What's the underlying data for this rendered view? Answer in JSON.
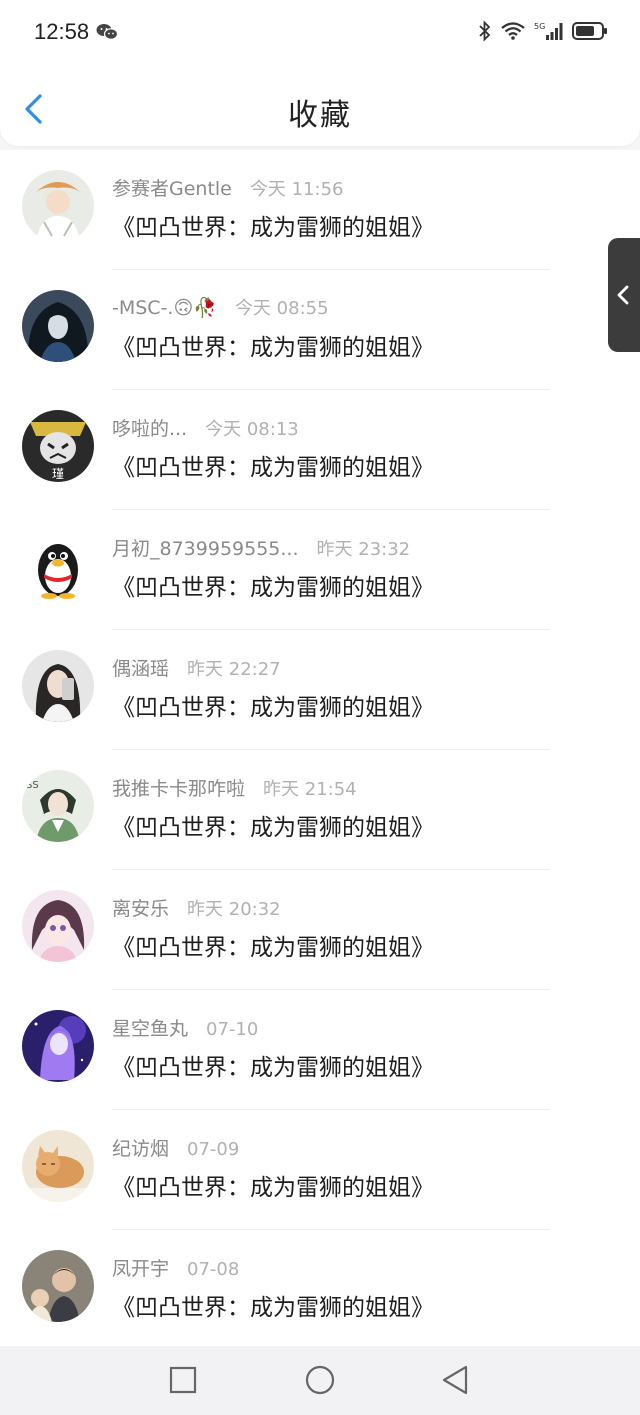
{
  "status_bar": {
    "time": "12:58"
  },
  "header": {
    "title": "收藏"
  },
  "items": [
    {
      "user": "参赛者Gentle",
      "time": "今天 11:56",
      "title": "《凹凸世界：成为雷狮的姐姐》"
    },
    {
      "user": "-MSC-.🙃🥀",
      "time": "今天 08:55",
      "title": "《凹凸世界：成为雷狮的姐姐》"
    },
    {
      "user": "哆啦的...",
      "time": "今天 08:13",
      "title": "《凹凸世界：成为雷狮的姐姐》"
    },
    {
      "user": "月初_8739959555...",
      "time": "昨天 23:32",
      "title": "《凹凸世界：成为雷狮的姐姐》"
    },
    {
      "user": "偶涵瑶",
      "time": "昨天 22:27",
      "title": "《凹凸世界：成为雷狮的姐姐》"
    },
    {
      "user": "我推卡卡那咋啦",
      "time": "昨天 21:54",
      "title": "《凹凸世界：成为雷狮的姐姐》"
    },
    {
      "user": "离安乐",
      "time": "昨天 20:32",
      "title": "《凹凸世界：成为雷狮的姐姐》"
    },
    {
      "user": "星空鱼丸",
      "time": "07-10",
      "title": "《凹凸世界：成为雷狮的姐姐》"
    },
    {
      "user": "纪访烟",
      "time": "07-09",
      "title": "《凹凸世界：成为雷狮的姐姐》"
    },
    {
      "user": "凤开宇",
      "time": "07-08",
      "title": "《凹凸世界：成为雷狮的姐姐》"
    }
  ],
  "colors": {
    "accent": "#2f8fe8",
    "title_text": "#1e1e1e",
    "meta_text": "#8a8a8a",
    "time_text": "#b1b1b1"
  },
  "icons": [
    "wechat-icon",
    "bluetooth-icon",
    "wifi-icon",
    "signal-5g-icon",
    "battery-icon",
    "back-arrow-icon",
    "chevron-left-icon",
    "square-icon",
    "circle-icon",
    "triangle-back-icon"
  ]
}
